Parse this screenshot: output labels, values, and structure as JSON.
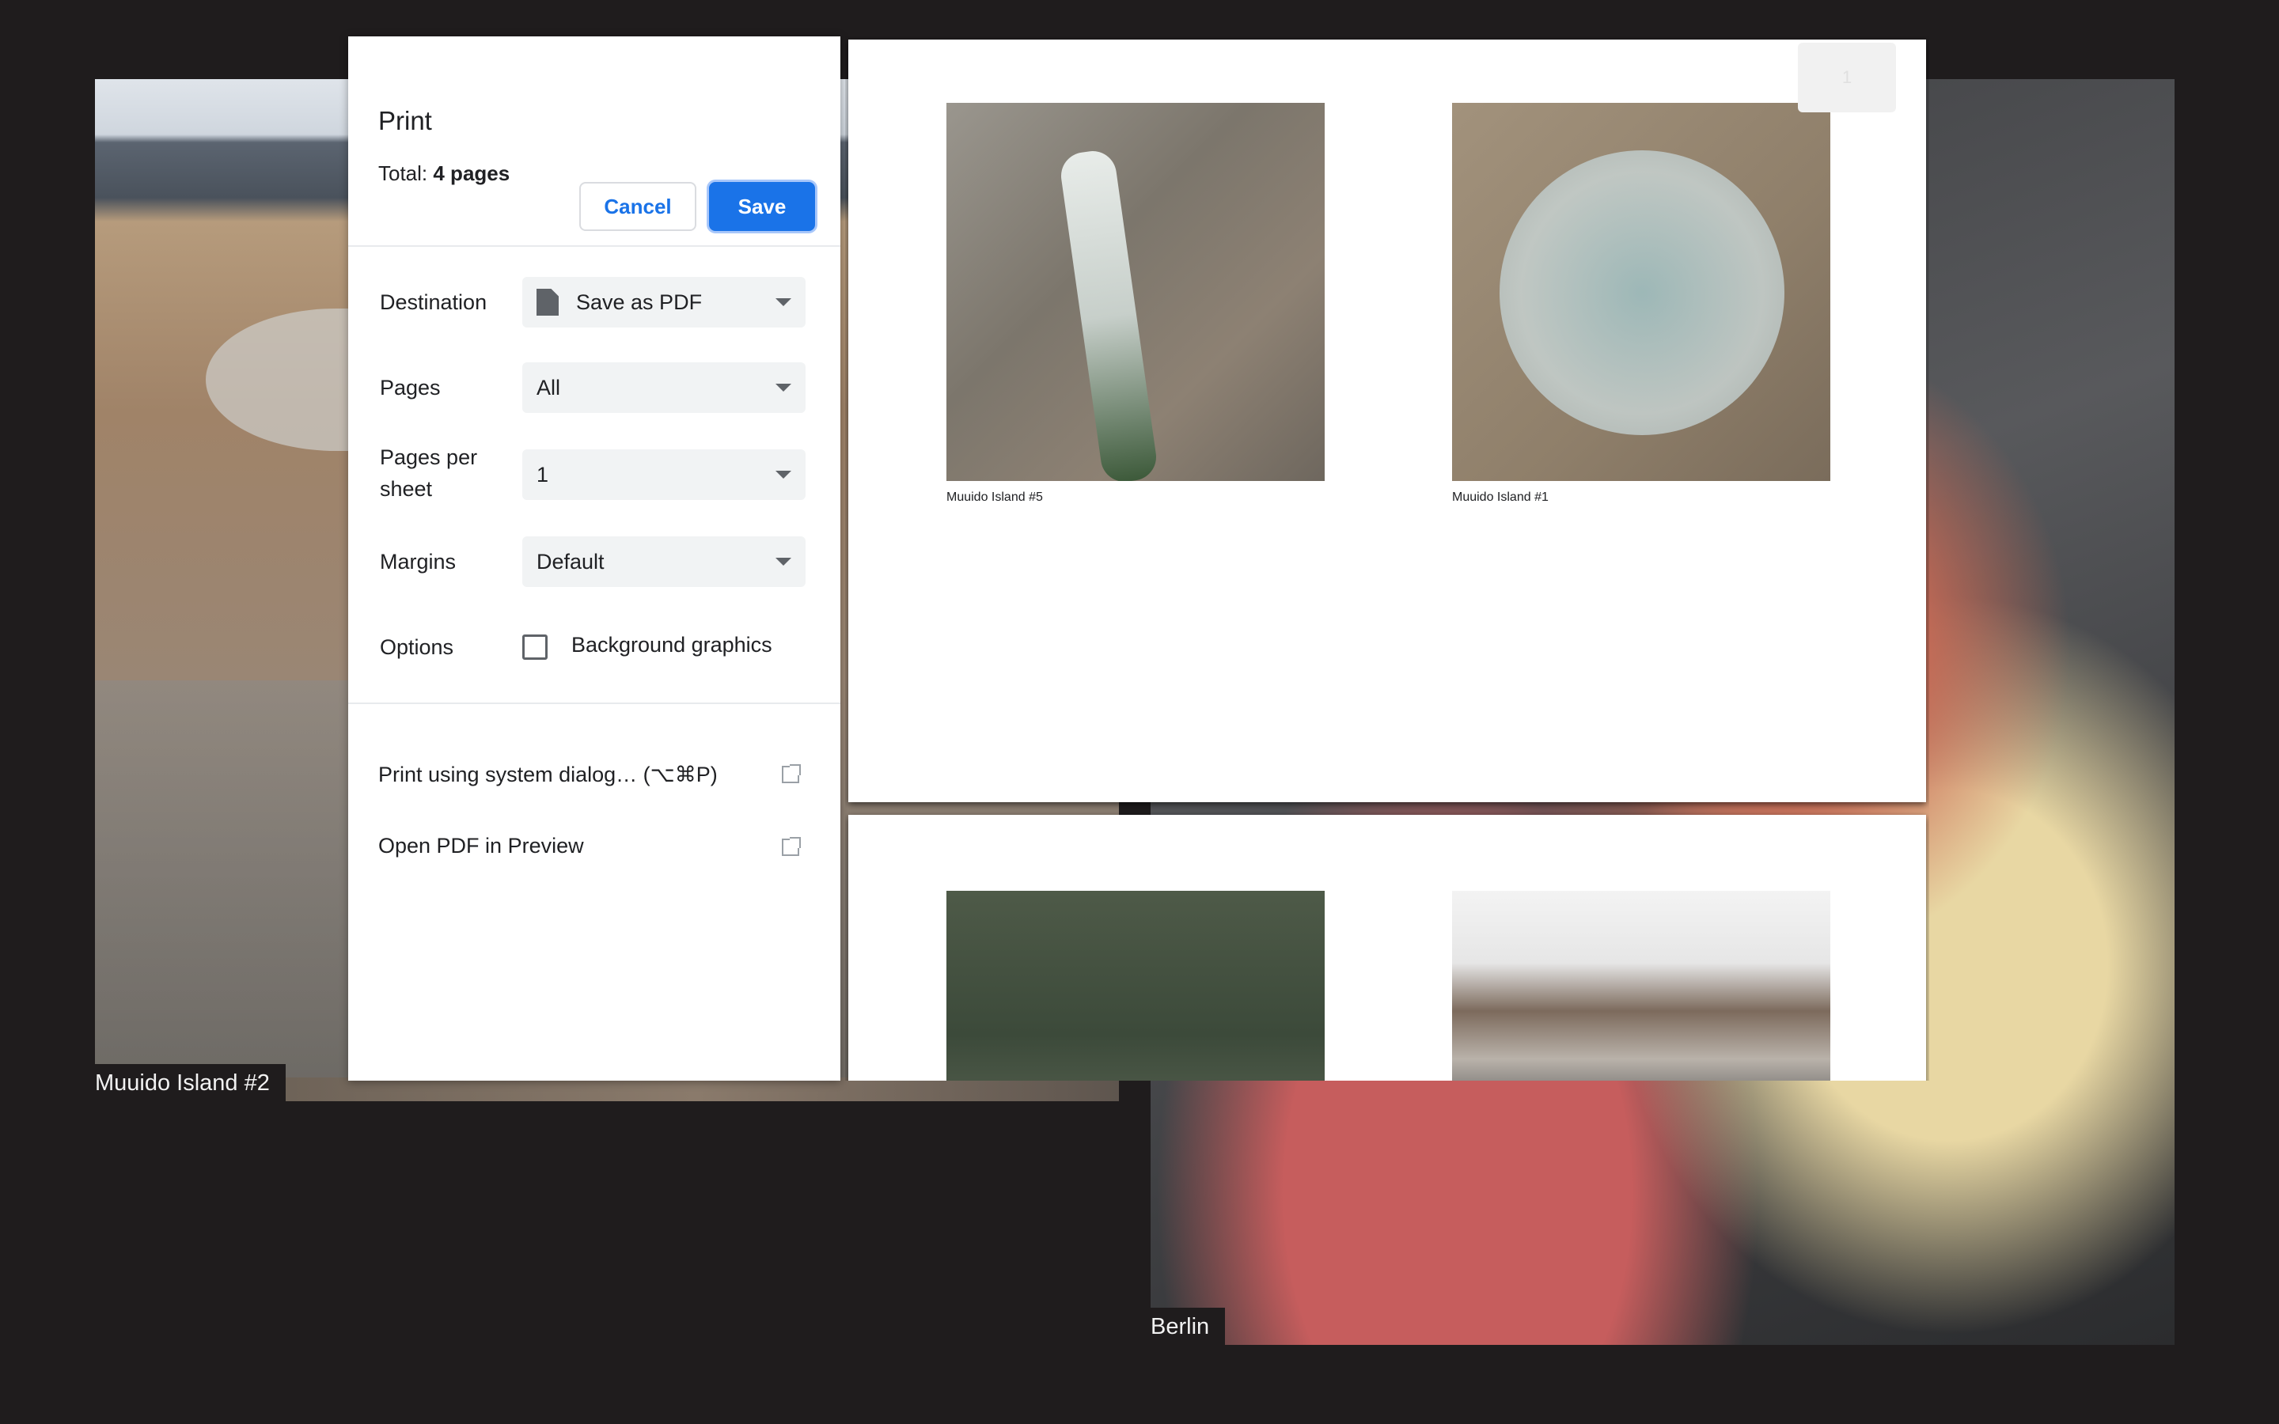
{
  "background": {
    "left_photo_caption": "Muuido Island #2",
    "right_photo_caption": "Berlin"
  },
  "dialog": {
    "title": "Print",
    "total_prefix": "Total: ",
    "total_value": "4 pages",
    "cancel_label": "Cancel",
    "save_label": "Save",
    "destination_label": "Destination",
    "destination_value": "Save as PDF",
    "pages_label": "Pages",
    "pages_value": "All",
    "pages_per_sheet_label": "Pages per sheet",
    "pages_per_sheet_value": "1",
    "margins_label": "Margins",
    "margins_value": "Default",
    "options_label": "Options",
    "background_graphics_label": "Background graphics",
    "background_graphics_checked": false,
    "system_dialog_label": "Print using system dialog… (⌥⌘P)",
    "open_preview_label": "Open PDF in Preview"
  },
  "preview": {
    "page_badge": "1",
    "page1_captions": [
      "Muuido Island #5",
      "Muuido Island #1"
    ]
  },
  "colors": {
    "accent": "#1a73e8",
    "background": "#1f1c1d"
  }
}
